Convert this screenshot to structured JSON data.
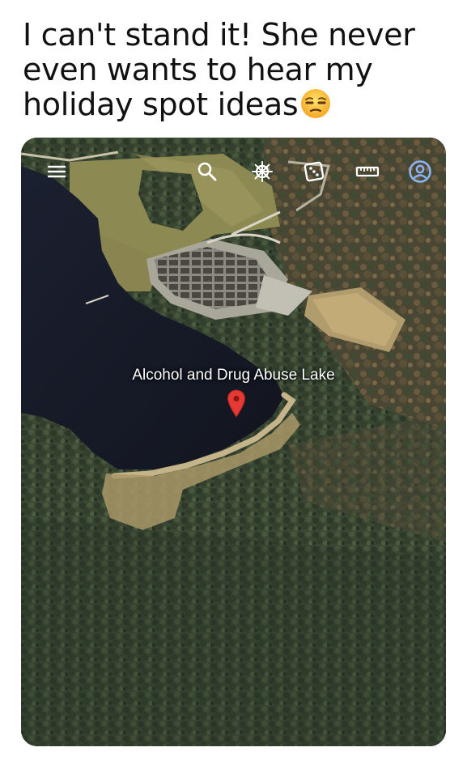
{
  "caption": {
    "text": "I can't stand it! She never even wants to hear my holiday spot ideas",
    "emoji": "unamused-face-emoji"
  },
  "map": {
    "place_label": "Alcohol and Drug Abuse Lake",
    "pin_icon": "red-location-pin-icon",
    "pin_color": "#e53935",
    "toolbar_icons": [
      "menu-icon",
      "search-icon",
      "voyager-wheel-icon",
      "dice-icon",
      "ruler-icon",
      "account-icon"
    ],
    "account_color": "#8ab4f8",
    "water_color": "#161a26",
    "forest_color": "#3a4733"
  }
}
